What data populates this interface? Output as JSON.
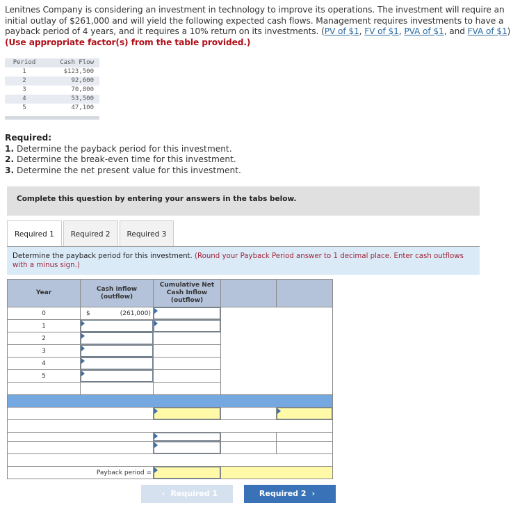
{
  "intro": {
    "text_1": "Lenitnes Company is considering an investment in technology to improve its operations. The investment will require an initial outlay of $261,000 and will yield the following expected cash flows. Management requires investments to have a payback period of 4 years, and it requires a 10% return on its investments. (",
    "links": [
      "PV of $1",
      "FV of $1",
      "PVA of $1",
      "FVA of $1"
    ],
    "sep_1": ", ",
    "sep_2": ", ",
    "sep_3": ", and ",
    "text_2": ") ",
    "emphasis": "(Use appropriate factor(s) from the table provided.)"
  },
  "cash_flow_table": {
    "headers": [
      "Period",
      "Cash Flow"
    ],
    "rows": [
      {
        "period": "1",
        "value": "$123,500"
      },
      {
        "period": "2",
        "value": "92,600"
      },
      {
        "period": "3",
        "value": "70,800"
      },
      {
        "period": "4",
        "value": "53,500"
      },
      {
        "period": "5",
        "value": "47,100"
      }
    ]
  },
  "required": {
    "title": "Required:",
    "items": [
      {
        "num": "1.",
        "text": " Determine the payback period for this investment."
      },
      {
        "num": "2.",
        "text": " Determine the break-even time for this investment."
      },
      {
        "num": "3.",
        "text": " Determine the net present value for this investment."
      }
    ]
  },
  "banner": "Complete this question by entering your answers in the tabs below.",
  "tabs": [
    {
      "label": "Required 1",
      "active": true
    },
    {
      "label": "Required 2",
      "active": false
    },
    {
      "label": "Required 3",
      "active": false
    }
  ],
  "instruction": {
    "text": "Determine the payback period for this investment. ",
    "note": "(Round your Payback Period answer to 1 decimal place. Enter cash outflows with a minus sign.)"
  },
  "answer_table": {
    "headers": [
      "Year",
      "Cash inflow (outflow)",
      "Cumulative Net Cash Inflow (outflow)",
      "",
      ""
    ],
    "years": [
      "0",
      "1",
      "2",
      "3",
      "4",
      "5"
    ],
    "currency_symbol": "$",
    "year0_cash": "(261,000)",
    "payback_label": "Payback period ="
  },
  "buttons": {
    "prev": "Required 1",
    "next": "Required 2",
    "prev_icon": "‹",
    "next_icon": "›"
  }
}
